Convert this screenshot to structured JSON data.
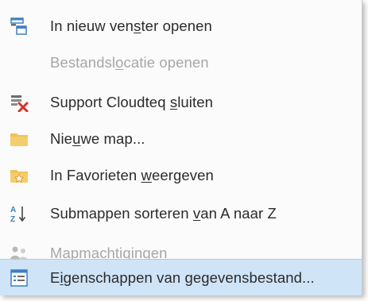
{
  "context_menu": {
    "items": [
      {
        "pre": "In nieuw ven",
        "key": "s",
        "post": "ter openen",
        "enabled": true,
        "icon": "new-window-icon"
      },
      {
        "pre": "Bestandsl",
        "key": "o",
        "post": "catie openen",
        "enabled": false,
        "icon": ""
      },
      {
        "pre": "Support Cloudteq ",
        "key": "s",
        "post": "luiten",
        "enabled": true,
        "icon": "close-data-file-icon"
      },
      {
        "pre": "Nie",
        "key": "u",
        "post": "we map...",
        "enabled": true,
        "icon": "folder-icon"
      },
      {
        "pre": "In Favorieten ",
        "key": "w",
        "post": "eergeven",
        "enabled": true,
        "icon": "favorites-folder-icon"
      },
      {
        "pre": "Submappen sorteren ",
        "key": "v",
        "post": "an A naar Z",
        "enabled": true,
        "icon": "sort-a-z-icon"
      },
      {
        "pre": "",
        "key": "M",
        "post": "apmachtigingen",
        "enabled": false,
        "icon": "folder-permissions-icon"
      },
      {
        "pre": "E",
        "key": "i",
        "post": "genschappen van gegevensbestand...",
        "enabled": true,
        "highlighted": true,
        "icon": "properties-icon"
      }
    ]
  },
  "colors": {
    "text": "#2b2b2b",
    "disabled_text": "#a7a7a7",
    "highlight": "#cfe4f7",
    "close_red": "#d3342b",
    "folder_yellow": "#f2c25a",
    "icon_blue": "#3d7fc4"
  }
}
